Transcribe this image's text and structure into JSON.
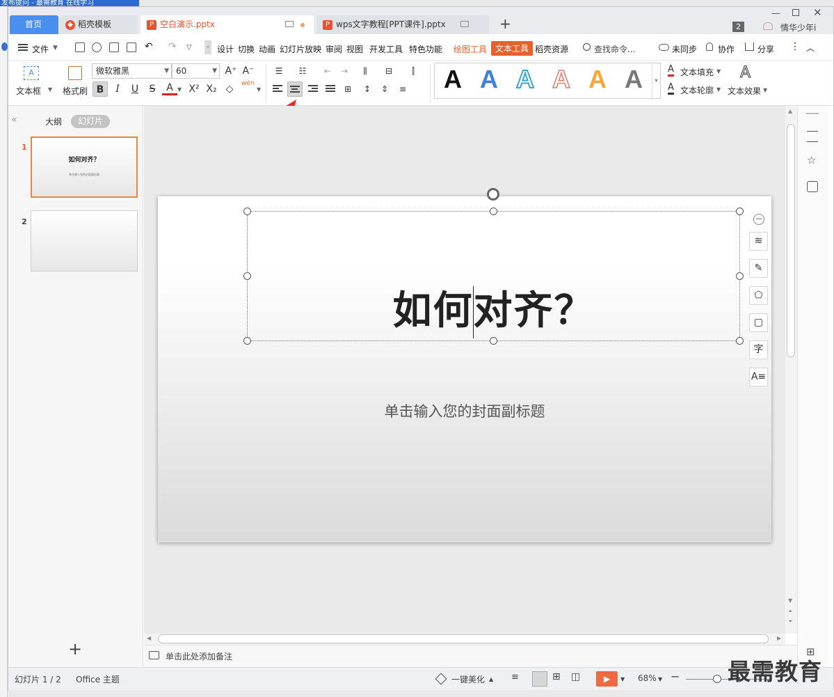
{
  "background_strip": "发布提问 - 最需教育 在线学习",
  "tabs": [
    {
      "label": "首页"
    },
    {
      "label": "稻壳模板"
    },
    {
      "label": "空白演示.pptx"
    },
    {
      "label": "wps文字教程[PPT课件].pptx"
    }
  ],
  "titlebar": {
    "badge": "2",
    "user": "情华少年i"
  },
  "menu": {
    "file": "文件",
    "items": [
      "设计",
      "切换",
      "动画",
      "幻灯片放映",
      "审阅",
      "视图",
      "开发工具",
      "特色功能"
    ],
    "drawing_tools": "绘图工具",
    "text_tools": "文本工具",
    "docer_resources": "稻壳资源",
    "search": "查找命令...",
    "unsynced": "未同步",
    "collab": "协作",
    "share": "分享"
  },
  "ribbon": {
    "textbox": "文本框",
    "format_painter": "格式刷",
    "font_name": "微软雅黑",
    "font_size": "60",
    "pinyin_top": "wén",
    "text_fill": "文本填充",
    "text_outline": "文本轮廓",
    "text_effect": "文本效果",
    "wordart_letter": "A"
  },
  "panel": {
    "outline_tab": "大纲",
    "slides_tab": "幻灯片",
    "add": "+"
  },
  "slides": [
    {
      "num": "1",
      "title": "如何对齐？",
      "subtitle": "单击输入您的封面副标题"
    },
    {
      "num": "2"
    }
  ],
  "slide": {
    "title": "如何对齐？",
    "subtitle": "单击输入您的封面副标题"
  },
  "notes": {
    "placeholder": "单击此处添加备注"
  },
  "status": {
    "slide_count": "幻灯片 1 / 2",
    "theme": "Office 主题",
    "beautify": "一键美化",
    "zoom": "68%"
  },
  "watermark": "最需教育",
  "colors": {
    "accent": "#e8602c",
    "tab_home": "#4a8ef0",
    "selection": "#e8863f"
  }
}
